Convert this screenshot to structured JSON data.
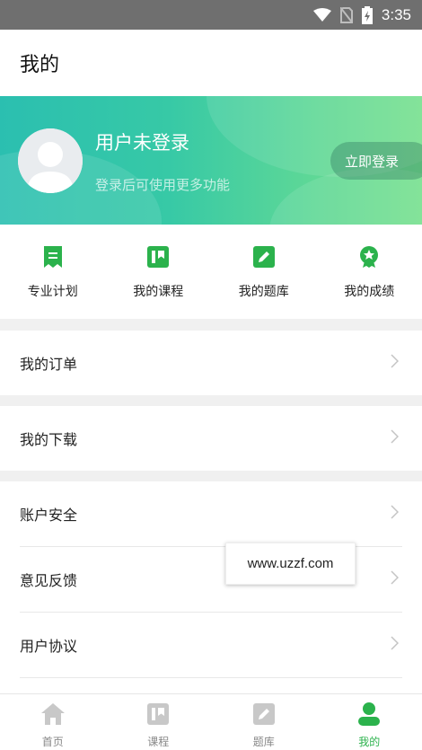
{
  "status_bar": {
    "time": "3:35"
  },
  "header": {
    "title": "我的"
  },
  "profile": {
    "name": "用户未登录",
    "subtitle": "登录后可使用更多功能",
    "login_button": "立即登录"
  },
  "quick_actions": [
    {
      "label": "专业计划",
      "icon": "plan-icon"
    },
    {
      "label": "我的课程",
      "icon": "course-icon"
    },
    {
      "label": "我的题库",
      "icon": "question-bank-icon"
    },
    {
      "label": "我的成绩",
      "icon": "score-icon"
    }
  ],
  "menu": {
    "orders": "我的订单",
    "downloads": "我的下载",
    "account_security": "账户安全",
    "feedback": "意见反馈",
    "user_agreement": "用户协议"
  },
  "watermark": "www.uzzf.com",
  "tabs": [
    {
      "label": "首页",
      "icon": "home-icon",
      "active": false
    },
    {
      "label": "课程",
      "icon": "course-icon",
      "active": false
    },
    {
      "label": "题库",
      "icon": "question-bank-icon",
      "active": false
    },
    {
      "label": "我的",
      "icon": "profile-icon",
      "active": true
    }
  ],
  "colors": {
    "accent": "#2bb24c",
    "banner_start": "#2bbfb0",
    "banner_end": "#76e08e",
    "tab_inactive": "#c8c8c8"
  }
}
